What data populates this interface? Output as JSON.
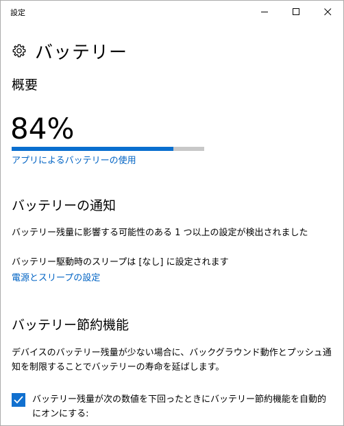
{
  "window": {
    "title": "設定",
    "minimize_icon": "minimize-icon",
    "maximize_icon": "maximize-icon",
    "close_icon": "close-icon"
  },
  "header": {
    "icon": "gear-icon",
    "title": "バッテリー"
  },
  "overview": {
    "heading": "概要",
    "percent_text": "84%",
    "charge_level": 0.84,
    "usage_link": "アプリによるバッテリーの使用",
    "accent": "#0a6fcf",
    "track": "#c8c8c8"
  },
  "notifications": {
    "heading": "バッテリーの通知",
    "detected_text": "バッテリー残量に影響する可能性のある 1 つ以上の設定が検出されました",
    "sleep_text": "バッテリー駆動時のスリープは [なし] に設定されます",
    "power_link": "電源とスリープの設定"
  },
  "saver": {
    "heading": "バッテリー節約機能",
    "desc_line1": "デバイスのバッテリー残量が少ない場合に、バックグラウンド動作とプッシュ通",
    "desc_line2": "知を制限することでバッテリーの寿命を延ばします。",
    "auto_on_checked": true,
    "auto_on_line1": "バッテリー残量が次の数値を下回ったときにバッテリー節約機能を自動的",
    "auto_on_line2": "にオンにする:"
  }
}
